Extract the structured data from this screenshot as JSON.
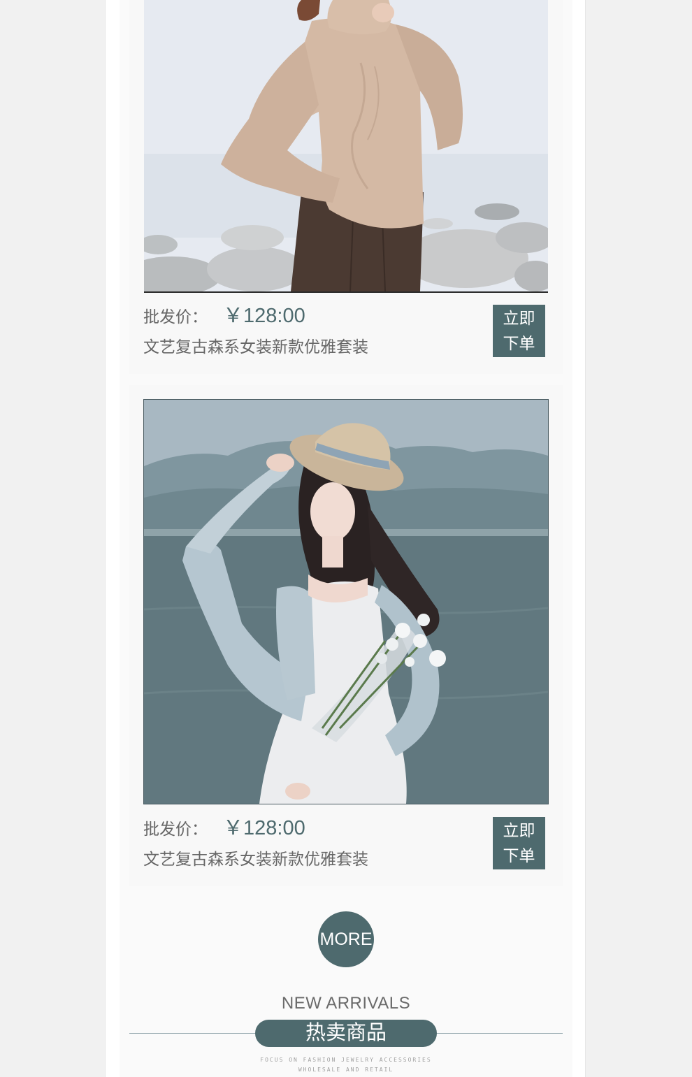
{
  "colors": {
    "accent": "#4e6a6e",
    "text_muted": "#666666",
    "card_bg": "#f8f8f8",
    "page_bg": "#f1f1f1"
  },
  "products": [
    {
      "image": "model-beige-turtleneck-sweater-brown-skirt-seaside-rocks",
      "price_label": "批发价：",
      "price": "￥128:00",
      "name": "文艺复古森系女装新款优雅套装",
      "order_line1": "立即",
      "order_line2": "下单"
    },
    {
      "image": "model-straw-hat-white-dress-blue-cardigan-flowers-lake",
      "price_label": "批发价：",
      "price": "￥128:00",
      "name": "文艺复古森系女装新款优雅套装",
      "order_line1": "立即",
      "order_line2": "下单"
    }
  ],
  "more_button": "MORE",
  "section": {
    "english_title": "NEW ARRIVALS",
    "chinese_title": "热卖商品",
    "tagline_line1": "FOCUS ON FASHION JEWELRY ACCESSORIES",
    "tagline_line2": "WHOLESALE AND RETAIL"
  }
}
